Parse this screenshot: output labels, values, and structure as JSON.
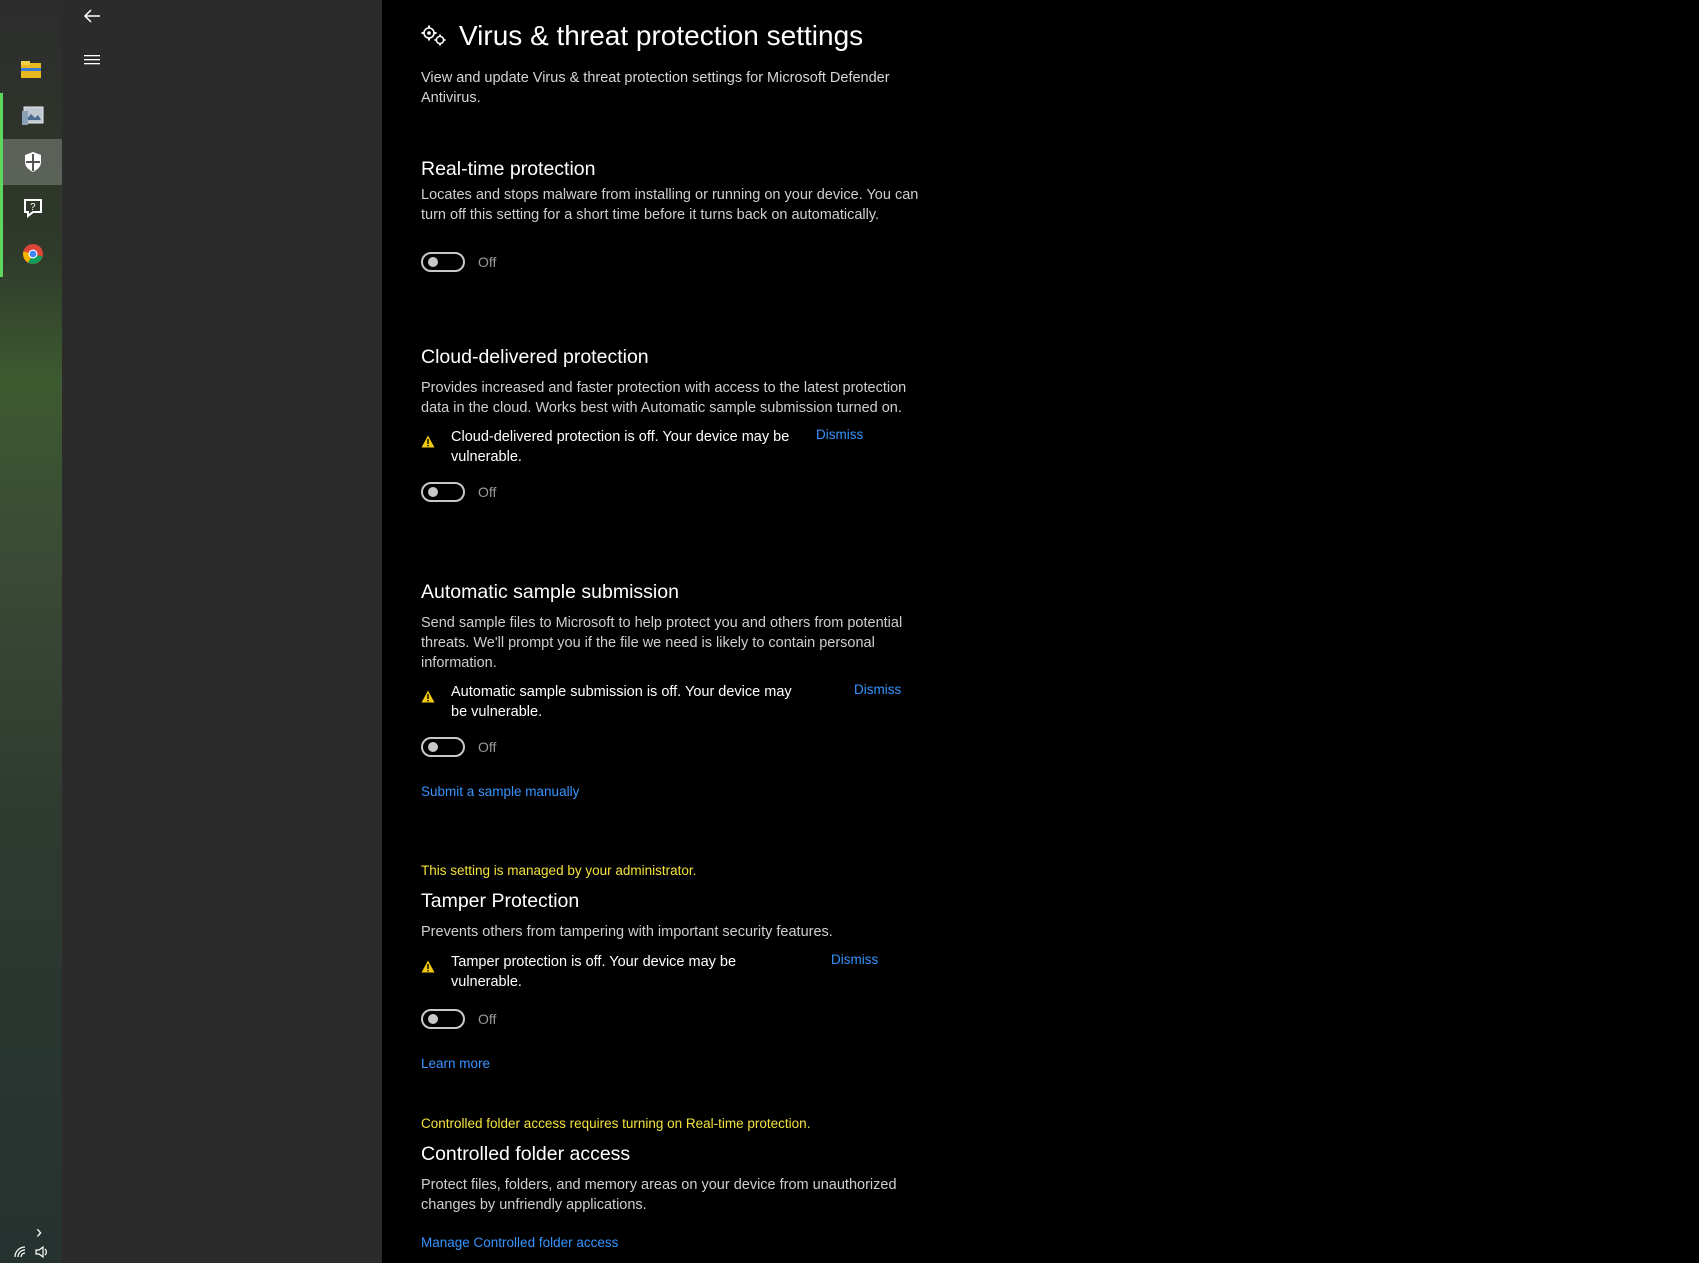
{
  "taskbar": {
    "apps": [
      {
        "name": "file-explorer"
      },
      {
        "name": "photos"
      },
      {
        "name": "windows-security"
      },
      {
        "name": "feedback-hub"
      },
      {
        "name": "google-chrome"
      }
    ],
    "tray_expand": "›"
  },
  "nav": {
    "back_glyph": "←",
    "menu_glyph": "≡"
  },
  "page": {
    "title": "Virus & threat protection settings",
    "description": "View and update Virus & threat protection settings for Microsoft Defender Antivirus."
  },
  "sections": {
    "realtime": {
      "title": "Real-time protection",
      "description": "Locates and stops malware from installing or running on your device. You can turn off this setting for a short time before it turns back on automatically.",
      "toggle_state": "Off"
    },
    "cloud": {
      "title": "Cloud-delivered protection",
      "description": "Provides increased and faster protection with access to the latest protection data in the cloud. Works best with Automatic sample submission turned on.",
      "warning": "Cloud-delivered protection is off. Your device may be vulnerable.",
      "dismiss": "Dismiss",
      "toggle_state": "Off"
    },
    "sample": {
      "title": "Automatic sample submission",
      "description": "Send sample files to Microsoft to help protect you and others from potential threats. We'll prompt you if the file we need is likely to contain personal information.",
      "warning": "Automatic sample submission is off. Your device may be vulnerable.",
      "dismiss": "Dismiss",
      "toggle_state": "Off",
      "link": "Submit a sample manually"
    },
    "tamper": {
      "admin_note": "This setting is managed by your administrator.",
      "title": "Tamper Protection",
      "description": "Prevents others from tampering with important security features.",
      "warning": "Tamper protection is off. Your device may be vulnerable.",
      "dismiss": "Dismiss",
      "toggle_state": "Off",
      "link": "Learn more"
    },
    "cfa": {
      "admin_note": "Controlled folder access requires turning on Real-time protection.",
      "title": "Controlled folder access",
      "description": "Protect files, folders, and memory areas on your device from unauthorized changes by unfriendly applications.",
      "link": "Manage Controlled folder access"
    }
  },
  "colors": {
    "accent_link": "#3794ff",
    "admin_text": "#f4e23c",
    "warning_icon": "#f2c811",
    "running_indicator": "#5ed65e"
  }
}
